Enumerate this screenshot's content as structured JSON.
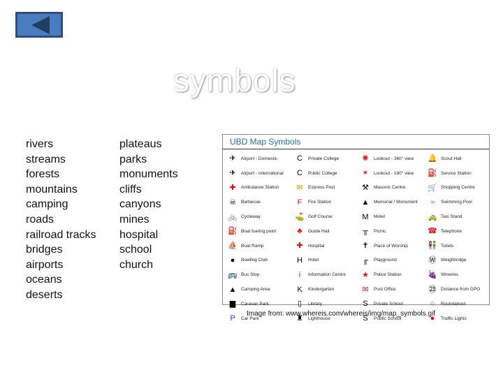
{
  "nav": {
    "back_icon": "left-triangle-icon"
  },
  "title": "symbols",
  "list_col1": [
    "rivers",
    "streams",
    "forests",
    "mountains",
    "camping",
    "roads",
    "railroad tracks",
    "bridges",
    "airports",
    "oceans",
    "deserts"
  ],
  "list_col2": [
    "plateaus",
    "parks",
    "monuments",
    "cliffs",
    "canyons",
    "mines",
    "hospital",
    "school",
    "church"
  ],
  "legend": {
    "title": "UBD Map Symbols",
    "columns": [
      [
        {
          "label": "Airport - Domestic",
          "icon": "airplane-icon",
          "glyph": "✈",
          "color": "#000"
        },
        {
          "label": "Airport - International",
          "icon": "airplane-icon",
          "glyph": "✈",
          "color": "#000"
        },
        {
          "label": "Ambulance Station",
          "icon": "red-cross-icon",
          "glyph": "✚",
          "color": "#e01010"
        },
        {
          "label": "Barbecue",
          "icon": "barbecue-icon",
          "glyph": "☠",
          "color": "#000"
        },
        {
          "label": "Cycleway",
          "icon": "bicycle-icon",
          "glyph": "🚲",
          "color": "#000"
        },
        {
          "label": "Boat fueling point",
          "icon": "fuel-icon",
          "glyph": "⛽",
          "color": "#1a3fc0"
        },
        {
          "label": "Boat Ramp",
          "icon": "boat-ramp-icon",
          "glyph": "⛵",
          "color": "#000"
        },
        {
          "label": "Bowling Club",
          "icon": "bowling-icon",
          "glyph": "●",
          "color": "#000"
        },
        {
          "label": "Bus Stop",
          "icon": "bus-icon",
          "glyph": "🚌",
          "color": "#1a3fc0"
        },
        {
          "label": "Camping Area",
          "icon": "tent-icon",
          "glyph": "▲",
          "color": "#000"
        },
        {
          "label": "Caravan Park",
          "icon": "caravan-icon",
          "glyph": "▆",
          "color": "#000"
        },
        {
          "label": "Car Park",
          "icon": "parking-icon",
          "glyph": "P",
          "color": "#1a3fc0"
        }
      ],
      [
        {
          "label": "Private College",
          "icon": "private-college-icon",
          "glyph": "C",
          "color": "#000"
        },
        {
          "label": "Public College",
          "icon": "public-college-icon",
          "glyph": "C",
          "color": "#000"
        },
        {
          "label": "Express Post",
          "icon": "envelope-icon",
          "glyph": "✉",
          "color": "#c89a00"
        },
        {
          "label": "Fire Station",
          "icon": "fire-station-icon",
          "glyph": "F",
          "color": "#e01010"
        },
        {
          "label": "Golf Course",
          "icon": "golf-flag-icon",
          "glyph": "⛳",
          "color": "#000"
        },
        {
          "label": "Guide Hall",
          "icon": "clover-icon",
          "glyph": "♣",
          "color": "#e01010"
        },
        {
          "label": "Hospital",
          "icon": "hospital-cross-icon",
          "glyph": "✚",
          "color": "#e01010"
        },
        {
          "label": "Hotel",
          "icon": "hotel-icon",
          "glyph": "H",
          "color": "#000"
        },
        {
          "label": "Information Centre",
          "icon": "info-icon",
          "glyph": "i",
          "color": "#1a3fc0"
        },
        {
          "label": "Kindergarten",
          "icon": "kindergarten-icon",
          "glyph": "K",
          "color": "#000"
        },
        {
          "label": "Library",
          "icon": "library-door-icon",
          "glyph": "▯",
          "color": "#000"
        },
        {
          "label": "Lighthouse",
          "icon": "lighthouse-icon",
          "glyph": "♜",
          "color": "#000"
        }
      ],
      [
        {
          "label": "Lookout - 360° view",
          "icon": "lookout-360-icon",
          "glyph": "✺",
          "color": "#e01010"
        },
        {
          "label": "Lookout - 180° view",
          "icon": "lookout-180-icon",
          "glyph": "✶",
          "color": "#e01010"
        },
        {
          "label": "Masonic Centre",
          "icon": "masonic-icon",
          "glyph": "⚒",
          "color": "#000"
        },
        {
          "label": "Memorial / Monument",
          "icon": "monument-icon",
          "glyph": "▲",
          "color": "#000"
        },
        {
          "label": "Motel",
          "icon": "motel-icon",
          "glyph": "M",
          "color": "#000"
        },
        {
          "label": "Picnic",
          "icon": "picnic-table-icon",
          "glyph": "╥",
          "color": "#000"
        },
        {
          "label": "Place of Worship",
          "icon": "worship-cross-icon",
          "glyph": "✝",
          "color": "#000"
        },
        {
          "label": "Playground",
          "icon": "swing-icon",
          "glyph": "╓",
          "color": "#000"
        },
        {
          "label": "Police Station",
          "icon": "star-icon",
          "glyph": "★",
          "color": "#e01010"
        },
        {
          "label": "Post Office",
          "icon": "post-envelope-icon",
          "glyph": "✉",
          "color": "#e01010"
        },
        {
          "label": "Private School",
          "icon": "private-school-icon",
          "glyph": "S",
          "color": "#000"
        },
        {
          "label": "Public School",
          "icon": "public-school-icon",
          "glyph": "S",
          "color": "#000"
        }
      ],
      [
        {
          "label": "Scout Hall",
          "icon": "scout-bell-icon",
          "glyph": "🔔",
          "color": "#e01010"
        },
        {
          "label": "Service Station",
          "icon": "service-station-icon",
          "glyph": "⛽",
          "color": "#000"
        },
        {
          "label": "Shopping Centre",
          "icon": "shopping-cart-icon",
          "glyph": "🛒",
          "color": "#e01010"
        },
        {
          "label": "Swimming Pool",
          "icon": "swimming-icon",
          "glyph": "≈",
          "color": "#1aa0c0"
        },
        {
          "label": "Taxi Stand",
          "icon": "taxi-icon",
          "glyph": "🚕",
          "color": "#1a3fc0"
        },
        {
          "label": "Telephone",
          "icon": "telephone-icon",
          "glyph": "☎",
          "color": "#e01010"
        },
        {
          "label": "Toilets",
          "icon": "toilets-icon",
          "glyph": "👫",
          "color": "#e01010"
        },
        {
          "label": "Weighbridge",
          "icon": "weighbridge-icon",
          "glyph": "Ⓦ",
          "color": "#000"
        },
        {
          "label": "Wineries",
          "icon": "grapes-icon",
          "glyph": "🍇",
          "color": "#4aa040"
        },
        {
          "label": "Distance from GPO",
          "icon": "distance-icon",
          "glyph": "㉓",
          "color": "#000"
        },
        {
          "label": "Roundabout",
          "icon": "roundabout-icon",
          "glyph": "○",
          "color": "#e01010"
        },
        {
          "label": "Traffic Lights",
          "icon": "traffic-lights-icon",
          "glyph": "●",
          "color": "#e01010"
        }
      ]
    ]
  },
  "caption": "Image from: www.whereis.com/whereis/img/map_symbols.gif"
}
